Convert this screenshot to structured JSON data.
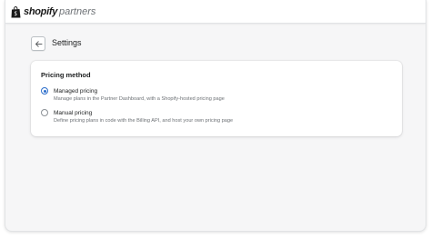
{
  "brand": {
    "name": "shopify",
    "sub": "partners",
    "accent": "#2c6ecb"
  },
  "header": {
    "back_icon": "arrow-left-icon",
    "title": "Settings"
  },
  "pricing_card": {
    "title": "Pricing method",
    "options": [
      {
        "label": "Managed pricing",
        "help": "Manage plans in the Partner Dashboard, with a Shopify-hosted pricing page",
        "selected": true
      },
      {
        "label": "Manual pricing",
        "help": "Define pricing plans in code with the Billing API, and host your own pricing page",
        "selected": false
      }
    ]
  }
}
